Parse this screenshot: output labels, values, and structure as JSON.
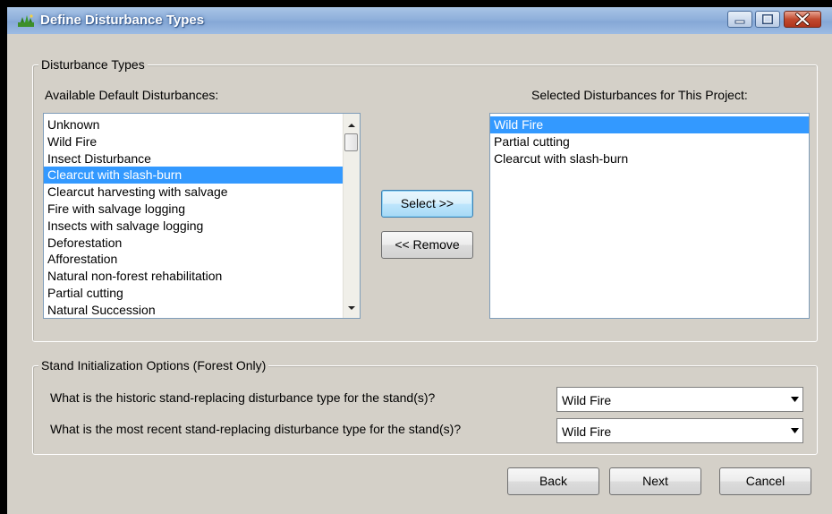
{
  "window": {
    "title": "Define Disturbance Types",
    "icon": "forest-app-icon"
  },
  "disturbance_types": {
    "legend": "Disturbance Types",
    "available_label": "Available Default Disturbances:",
    "available_items": [
      "Unknown",
      "Wild Fire",
      "Insect Disturbance",
      "Clearcut with slash-burn",
      "Clearcut harvesting with salvage",
      "Fire with salvage logging",
      "Insects with salvage logging",
      "Deforestation",
      "Afforestation",
      "Natural non-forest rehabilitation",
      "Partial cutting",
      "Natural Succession"
    ],
    "available_selected": "Clearcut with slash-burn",
    "selected_label": "Selected Disturbances for This Project:",
    "selected_items": [
      "Wild Fire",
      "Partial cutting",
      "Clearcut with slash-burn"
    ],
    "selected_selected": "Wild Fire",
    "select_button": "Select >>",
    "remove_button": "<< Remove"
  },
  "stand_init": {
    "legend": "Stand Initialization Options (Forest Only)",
    "historic_question": "What is the historic stand-replacing disturbance type for the stand(s)?",
    "historic_value": "Wild Fire",
    "recent_question": "What is the most recent stand-replacing disturbance type for the stand(s)?",
    "recent_value": "Wild Fire"
  },
  "footer": {
    "back": "Back",
    "next": "Next",
    "cancel": "Cancel"
  }
}
